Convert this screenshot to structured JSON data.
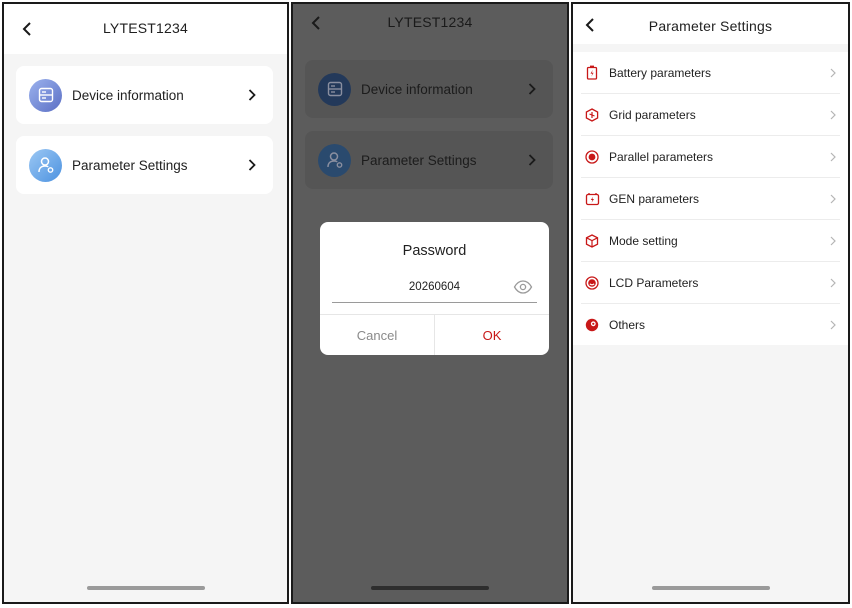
{
  "screen1": {
    "title": "LYTEST1234",
    "cards": [
      {
        "label": "Device information",
        "icon": "server-icon"
      },
      {
        "label": "Parameter Settings",
        "icon": "user-gear-icon"
      }
    ]
  },
  "screen2": {
    "title": "LYTEST1234",
    "cards": [
      {
        "label": "Device information",
        "icon": "server-icon"
      },
      {
        "label": "Parameter Settings",
        "icon": "user-gear-icon"
      }
    ],
    "dialog": {
      "title": "Password",
      "password_value": "20260604",
      "cancel_label": "Cancel",
      "ok_label": "OK"
    }
  },
  "screen3": {
    "title": "Parameter Settings",
    "items": [
      {
        "label": "Battery parameters",
        "icon": "battery-icon"
      },
      {
        "label": "Grid parameters",
        "icon": "grid-icon"
      },
      {
        "label": "Parallel parameters",
        "icon": "parallel-icon"
      },
      {
        "label": "GEN parameters",
        "icon": "generator-icon"
      },
      {
        "label": "Mode setting",
        "icon": "cube-icon"
      },
      {
        "label": "LCD Parameters",
        "icon": "lcd-icon"
      },
      {
        "label": "Others",
        "icon": "others-icon"
      }
    ]
  },
  "colors": {
    "accent_red": "#c81818",
    "overlay": "#5c5c5c",
    "icon_gradient_start": "#8fa7ea",
    "icon_gradient_end": "#5a6fc2"
  }
}
